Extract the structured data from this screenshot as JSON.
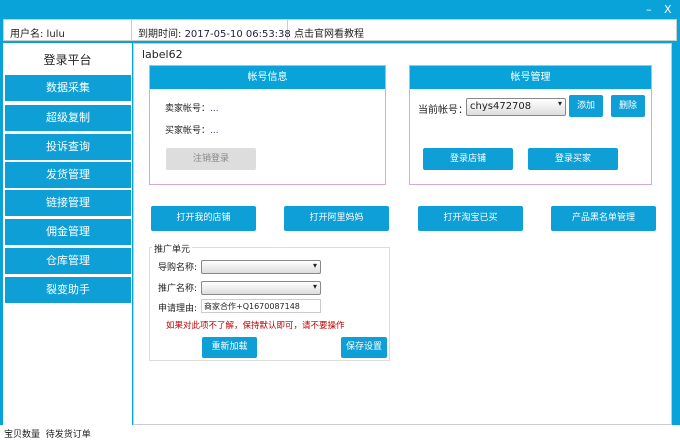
{
  "window": {
    "minimize": "–",
    "close": "X"
  },
  "info": {
    "user": "用户名: lulu",
    "expire_label": "到期时间: ",
    "expire_value": "2017-05-10 06:53:38",
    "tutorial": "点击官网看教程"
  },
  "sidebar": {
    "title": "登录平台",
    "items": [
      "数据采集",
      "超级复制",
      "投诉查询",
      "发货管理",
      "链接管理",
      "佣金管理",
      "仓库管理",
      "裂变助手"
    ]
  },
  "main": {
    "label": "label62",
    "account_info": {
      "title": "帐号信息",
      "seller_label": "卖家帐号：",
      "seller_value": "...",
      "buyer_label": "买家帐号：",
      "buyer_value": "...",
      "logout": "注销登录"
    },
    "account_mgmt": {
      "title": "帐号管理",
      "current_label": "当前帐号：",
      "current_value": "chys472708",
      "add": "添加",
      "delete": "删除",
      "login_shop": "登录店铺",
      "login_buyer": "登录买家"
    },
    "actions": [
      "打开我的店铺",
      "打开阿里妈妈",
      "打开淘宝已买",
      "产品黑名单管理"
    ],
    "promo": {
      "title": "推广单元",
      "guide_label": "导购名称:",
      "promo_label": "推广名称:",
      "reason_label": "申请理由:",
      "reason_value": "商家合作+Q1670087148",
      "warning": "如果对此项不了解，保持默认即可，请不要操作",
      "reload": "重新加载",
      "save": "保存设置"
    }
  },
  "status": {
    "text1": "宝贝数量",
    "text2": "待发货订单"
  },
  "colors": {
    "accent": "#0aa3d9",
    "warning": "#c00000"
  }
}
